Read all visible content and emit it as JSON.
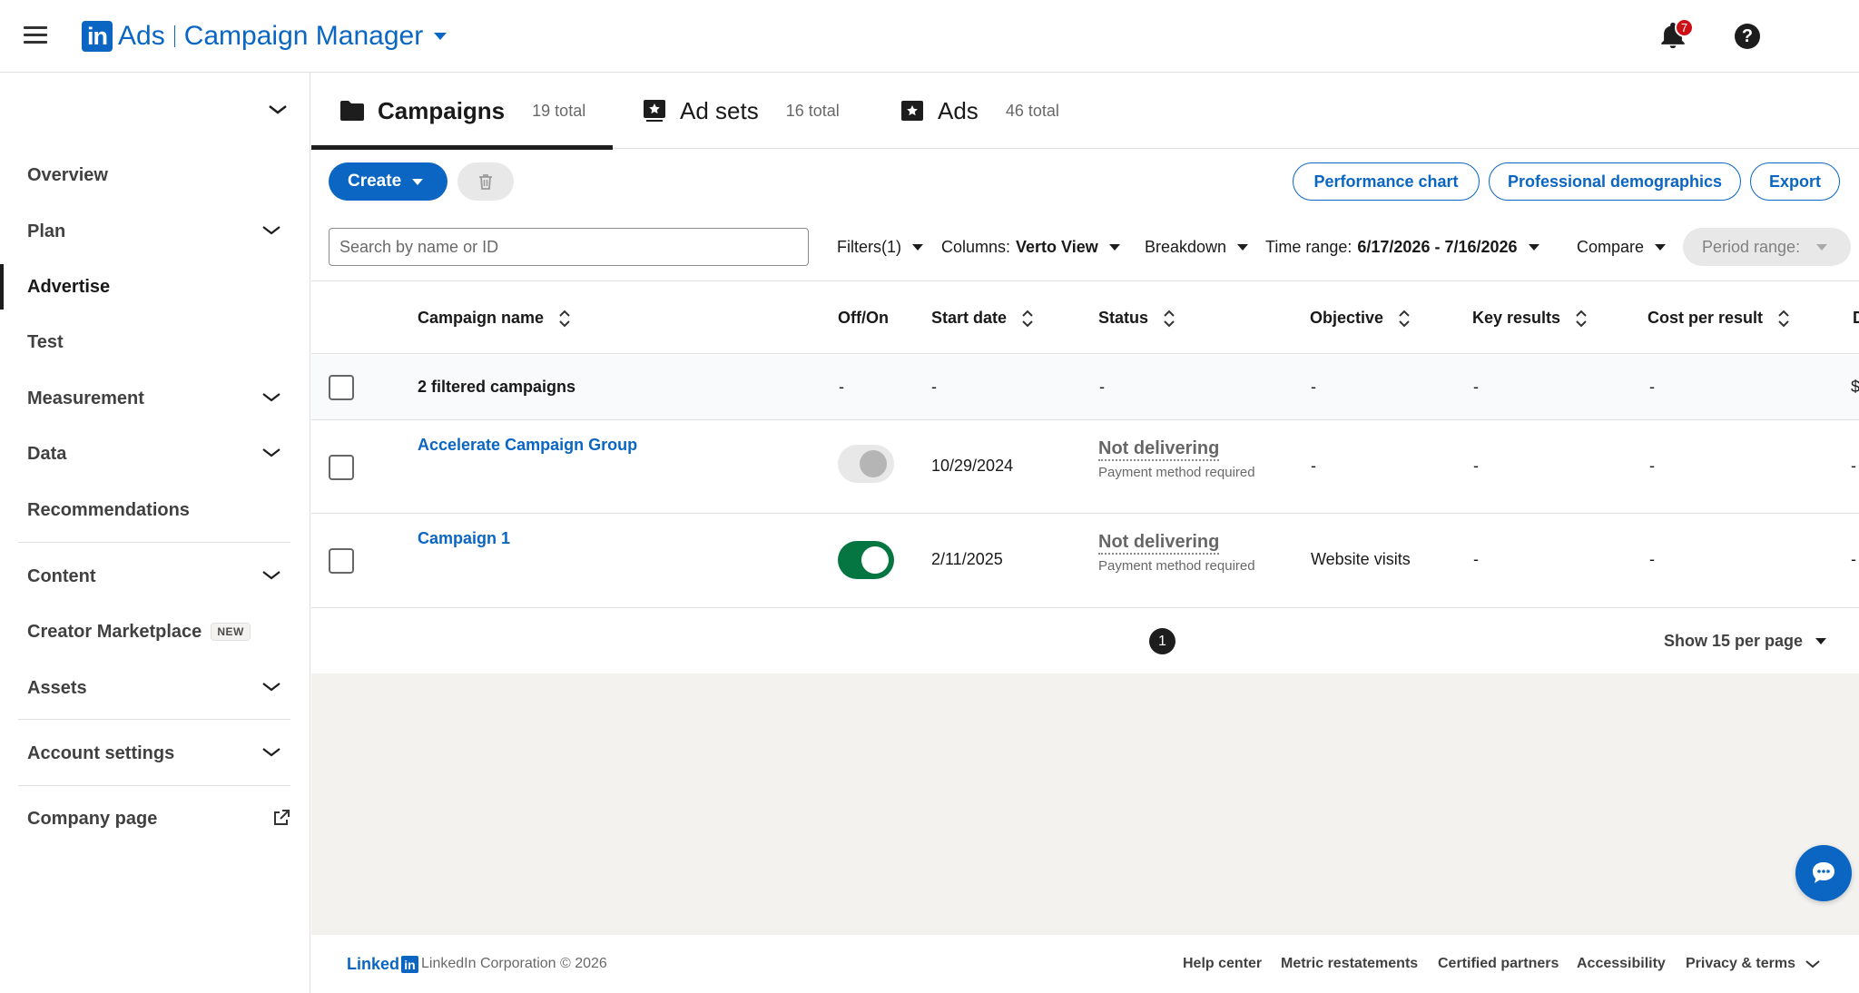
{
  "header": {
    "logo_ads": "Ads",
    "logo_product": "Campaign Manager",
    "notification_count": "7"
  },
  "sidebar": {
    "items": [
      {
        "label": "Overview"
      },
      {
        "label": "Plan"
      },
      {
        "label": "Advertise"
      },
      {
        "label": "Test"
      },
      {
        "label": "Measurement"
      },
      {
        "label": "Data"
      },
      {
        "label": "Recommendations"
      },
      {
        "label": "Content"
      },
      {
        "label": "Creator Marketplace",
        "badge": "NEW"
      },
      {
        "label": "Assets"
      },
      {
        "label": "Account settings"
      },
      {
        "label": "Company page"
      }
    ]
  },
  "tabs": [
    {
      "label": "Campaigns",
      "count": "19 total"
    },
    {
      "label": "Ad sets",
      "count": "16 total"
    },
    {
      "label": "Ads",
      "count": "46 total"
    }
  ],
  "toolbar": {
    "create_label": "Create",
    "performance_chart": "Performance chart",
    "professional_demographics": "Professional demographics",
    "export": "Export"
  },
  "filters": {
    "search_placeholder": "Search by name or ID",
    "filters_label": "Filters(1)",
    "columns_label": "Columns:",
    "columns_value": "Verto View",
    "breakdown_label": "Breakdown",
    "time_range_label": "Time range:",
    "time_range_value": "6/17/2026 - 7/16/2026",
    "compare_label": "Compare",
    "period_range_label": "Period range:"
  },
  "table": {
    "columns": [
      "Campaign name",
      "Off/On",
      "Start date",
      "Status",
      "Objective",
      "Key results",
      "Cost per result",
      "D"
    ],
    "summary": {
      "name": "2 filtered campaigns",
      "offon": "-",
      "start": "-",
      "status": "-",
      "objective": "-",
      "key": "-",
      "cost": "-",
      "extra": "$"
    },
    "rows": [
      {
        "name": "Accelerate Campaign Group",
        "toggle": "off",
        "start": "10/29/2024",
        "status": "Not delivering",
        "status_sub": "Payment method required",
        "objective": "-",
        "key": "-",
        "cost": "-",
        "extra": "-"
      },
      {
        "name": "Campaign 1",
        "toggle": "on",
        "start": "2/11/2025",
        "status": "Not delivering",
        "status_sub": "Payment method required",
        "objective": "Website visits",
        "key": "-",
        "cost": "-",
        "extra": "-"
      }
    ]
  },
  "pagination": {
    "current_page": "1",
    "per_page": "Show 15 per page"
  },
  "footer": {
    "logo_text": "Linked",
    "logo_box": "in",
    "copyright": "LinkedIn Corporation © 2026",
    "links": [
      "Help center",
      "Metric restatements",
      "Certified partners",
      "Accessibility",
      "Privacy & terms"
    ]
  }
}
